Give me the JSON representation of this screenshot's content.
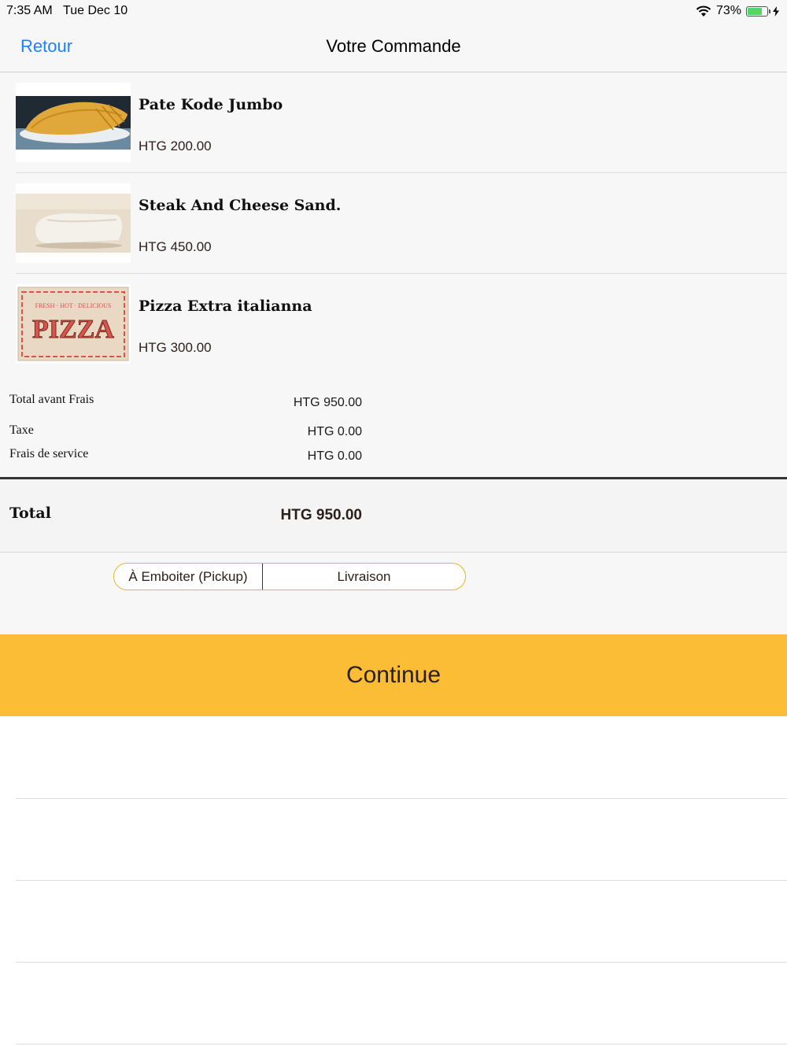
{
  "status": {
    "time": "7:35 AM",
    "date": "Tue Dec 10",
    "battery": "73%",
    "battery_level": 0.73,
    "wifi_icon": "wifi-icon",
    "charging_icon": "bolt-icon"
  },
  "nav": {
    "back_label": "Retour",
    "title": "Votre Commande"
  },
  "items": [
    {
      "name": "Pate Kode Jumbo",
      "price": "HTG 200.00"
    },
    {
      "name": "Steak And Cheese Sand.",
      "price": "HTG 450.00"
    },
    {
      "name": "Pizza Extra italianna",
      "price": "HTG 300.00"
    }
  ],
  "pizza_box": {
    "top_text": "FRESH · HOT · DELICIOUS",
    "big_text": "PIZZA"
  },
  "summary": {
    "subtotal_label": "Total avant Frais",
    "subtotal_value": "HTG 950.00",
    "tax_label": "Taxe",
    "tax_value": "HTG 0.00",
    "service_label": "Frais de service",
    "service_value": "HTG 0.00"
  },
  "total": {
    "label": "Total",
    "value": "HTG 950.00"
  },
  "delivery": {
    "options": [
      "À Emboiter (Pickup)",
      "Livraison"
    ]
  },
  "continue_label": "Continue",
  "colors": {
    "accent": "#fbbd36",
    "link": "#1a82fb",
    "segment_border": "#f0b12b"
  }
}
